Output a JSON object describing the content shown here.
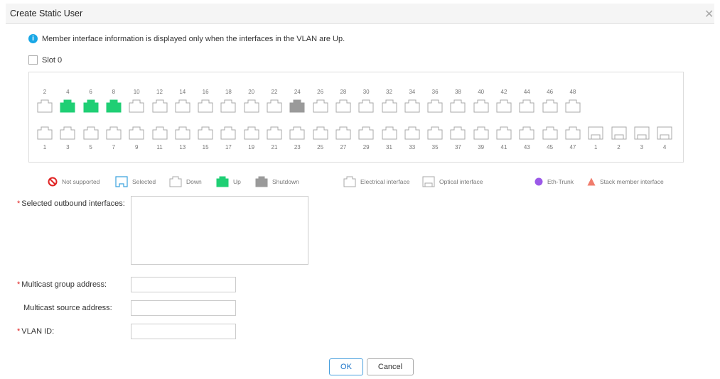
{
  "dialog": {
    "title": "Create Static User",
    "close_icon": "close-icon",
    "info_text": "Member interface information is displayed only when the interfaces in the VLAN are Up.",
    "slot_label": "Slot 0"
  },
  "ports": {
    "top_numbers": [
      "2",
      "4",
      "6",
      "8",
      "10",
      "12",
      "14",
      "16",
      "18",
      "20",
      "22",
      "24",
      "26",
      "28",
      "30",
      "32",
      "34",
      "36",
      "38",
      "40",
      "42",
      "44",
      "46",
      "48"
    ],
    "bottom_numbers": [
      "1",
      "3",
      "5",
      "7",
      "9",
      "11",
      "13",
      "15",
      "17",
      "19",
      "21",
      "23",
      "25",
      "27",
      "29",
      "31",
      "33",
      "35",
      "37",
      "39",
      "41",
      "43",
      "45",
      "47"
    ],
    "optical_numbers": [
      "1",
      "2",
      "3",
      "4"
    ],
    "top_states": [
      "down",
      "up",
      "up",
      "up",
      "down",
      "down",
      "down",
      "down",
      "down",
      "down",
      "down",
      "shutdown",
      "down",
      "down",
      "down",
      "down",
      "down",
      "down",
      "down",
      "down",
      "down",
      "down",
      "down",
      "down"
    ],
    "bottom_states": [
      "down",
      "down",
      "down",
      "down",
      "down",
      "down",
      "down",
      "down",
      "down",
      "down",
      "down",
      "down",
      "down",
      "down",
      "down",
      "down",
      "down",
      "down",
      "down",
      "down",
      "down",
      "down",
      "down",
      "down"
    ],
    "optical_states": [
      "optical",
      "optical",
      "optical",
      "optical"
    ]
  },
  "legend": {
    "not_supported": "Not supported",
    "selected": "Selected",
    "down": "Down",
    "up": "Up",
    "shutdown": "Shutdown",
    "electrical": "Electrical interface",
    "optical": "Optical interface",
    "eth_trunk": "Eth-Trunk",
    "stack_member": "Stack member interface"
  },
  "form": {
    "required_mark": "*",
    "outbound_label": "Selected outbound interfaces:",
    "group_label": "Multicast group address:",
    "source_label": "Multicast source address:",
    "vlan_label": "VLAN ID:",
    "outbound_value": "",
    "group_value": "",
    "source_value": "",
    "vlan_value": ""
  },
  "buttons": {
    "ok": "OK",
    "cancel": "Cancel"
  },
  "colors": {
    "up": "#1fcf74",
    "shutdown": "#9a9a9a",
    "down_border": "#a8a8a8",
    "selected_border": "#3aa2de",
    "eth_trunk": "#9b59e8",
    "stack_member": "#f07c6c",
    "not_supported": "#e02424"
  }
}
